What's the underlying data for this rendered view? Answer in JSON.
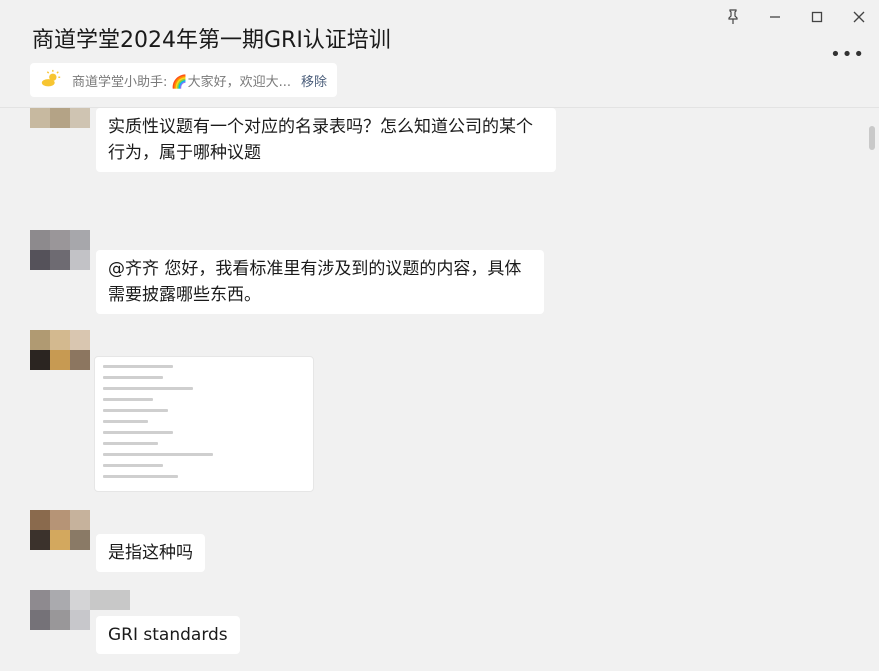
{
  "window": {
    "title": "商道学堂2024年第一期GRI认证培训",
    "pin_icon": "pin-icon",
    "minimize_icon": "minimize-icon",
    "maximize_icon": "maximize-icon",
    "close_icon": "close-icon",
    "more_icon": "more-icon"
  },
  "pinned": {
    "sender": "商道学堂小助手:",
    "preview": "🌈大家好，欢迎大...",
    "remove_label": "移除"
  },
  "messages": [
    {
      "type": "text",
      "text_line1": "实质性议题有一个对应的名录表吗？怎么知道公司的某个",
      "text_line2": "行为，属于哪种议题"
    },
    {
      "type": "text",
      "text_line1": "@齐齐 您好，我看标准里有涉及到的议题的内容，具体",
      "text_line2": "需要披露哪些东西。"
    },
    {
      "type": "image"
    },
    {
      "type": "text",
      "text_line1": "是指这种吗"
    },
    {
      "type": "text",
      "text_line1": "GRI standards"
    }
  ]
}
